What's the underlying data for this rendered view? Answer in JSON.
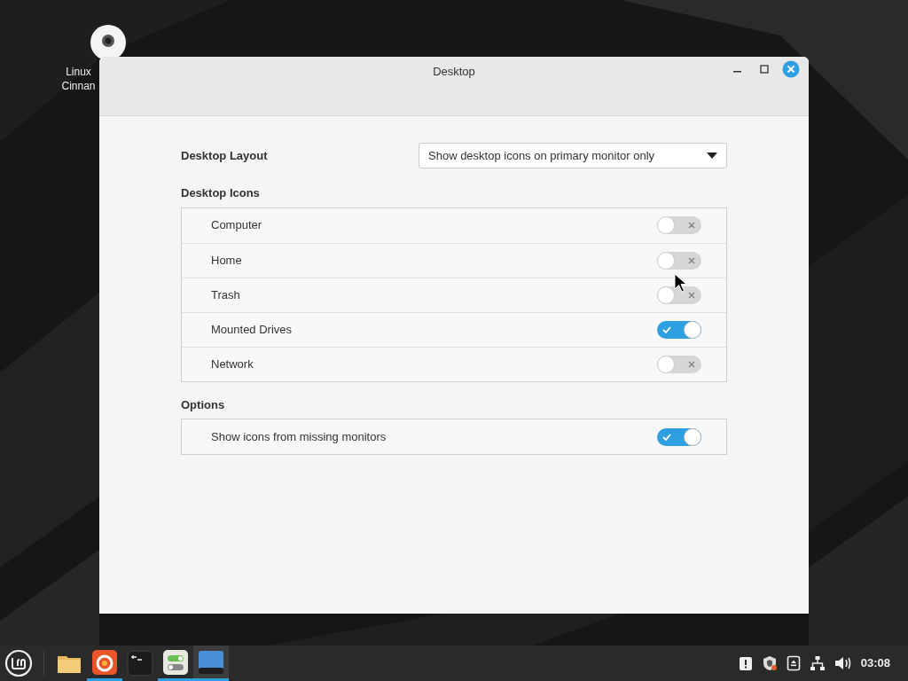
{
  "desktop_icon": {
    "label_lines": [
      "Linux",
      "Cinnan"
    ]
  },
  "window": {
    "title": "Desktop"
  },
  "layout": {
    "label": "Desktop Layout",
    "value": "Show desktop icons on primary monitor only"
  },
  "icons_section": {
    "title": "Desktop Icons",
    "items": [
      {
        "label": "Computer",
        "on": false
      },
      {
        "label": "Home",
        "on": false
      },
      {
        "label": "Trash",
        "on": false
      },
      {
        "label": "Mounted Drives",
        "on": true
      },
      {
        "label": "Network",
        "on": false
      }
    ]
  },
  "options_section": {
    "title": "Options",
    "items": [
      {
        "label": "Show icons from missing monitors",
        "on": true
      }
    ]
  },
  "taskbar": {
    "apps": [
      {
        "kind": "folder",
        "running": false,
        "selected": false
      },
      {
        "kind": "browser",
        "running": true,
        "selected": false
      },
      {
        "kind": "terminal",
        "running": false,
        "selected": false
      },
      {
        "kind": "settings",
        "running": true,
        "selected": false
      },
      {
        "kind": "desktop",
        "running": true,
        "selected": true
      }
    ],
    "clock": "03:08"
  }
}
